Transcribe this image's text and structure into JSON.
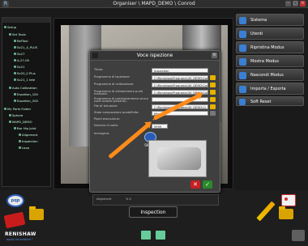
{
  "window": {
    "title": "Organiser \\ MAPD_DEMO \\ Conrod"
  },
  "tree": {
    "items": [
      "Setup",
      "Set Tools",
      "RefTool",
      "Sx21_4_PLUS",
      "Sx27",
      "A-27-09",
      "Sx21",
      "Sx20_0 Plus",
      "Sx21_1 tele",
      "Auto Calibration",
      "Equation_100",
      "Equation_200",
      "My Parts Folder",
      "Sphere",
      "MAPD_DEMO",
      "Bar Hip Joint",
      "Alignment",
      "Inspection",
      "Loop"
    ]
  },
  "right_panel": {
    "items": [
      {
        "label": "Sistema",
        "icon": "system-icon"
      },
      {
        "label": "Utenti",
        "icon": "users-icon"
      },
      {
        "label": "Ripristina Modus",
        "icon": "restore-icon"
      },
      {
        "label": "Mostra Modus",
        "icon": "show-icon"
      },
      {
        "label": "Nascondi Modus",
        "icon": "hide-icon"
      },
      {
        "label": "Importa / Esporta",
        "icon": "import-export-icon"
      },
      {
        "label": "Soft Reset",
        "icon": "reset-icon"
      }
    ]
  },
  "dialog": {
    "title": "Voce ispezione",
    "fields": {
      "titolo": {
        "label": "Titolo:",
        "value": "Inspection"
      },
      "prog_ispezione": {
        "label": "Programma di ispezione:",
        "value": "C:\\Renishaw\\Programs\\UK_DEMO\\Con"
      },
      "prog_calibrazione": {
        "label": "Programma di calibrazione:",
        "value": "C:\\Renishaw\\Programs\\UK_DEMO\\Con"
      },
      "prog_allineamento": {
        "label": "Programma di allineamento punti manuale:",
        "value": "C:\\Renishaw\\Programs\\UK_DEMO\\Con Rod\\"
      },
      "prog_posizionamento": {
        "label": "Programma di posizionamento sicuro (solo scatola pulsanti):",
        "value": ""
      },
      "file_istruzioni": {
        "label": "File di istruzioni:",
        "value": "C:\\Renishaw\\Programs\\UK_DEMO\\Cr image"
      },
      "stato_comparatore": {
        "label": "Stato comparatore predefinito:",
        "value": "Misura"
      },
      "pipeli_esecuzione": {
        "label": "Pipeli esecuzione:",
        "value": "✔"
      },
      "numero_volte": {
        "label": "Numero di volte:",
        "value": "9999"
      },
      "immagine": {
        "label": "Immagine:"
      }
    },
    "browse_label": "Sfoglia"
  },
  "bottom": {
    "tab_label": "Inspection",
    "info_left": "Alignment",
    "info_mid": "% 0",
    "logo": "RENISHAW",
    "tagline": "apply innovation™",
    "probe_label": "pqp"
  }
}
